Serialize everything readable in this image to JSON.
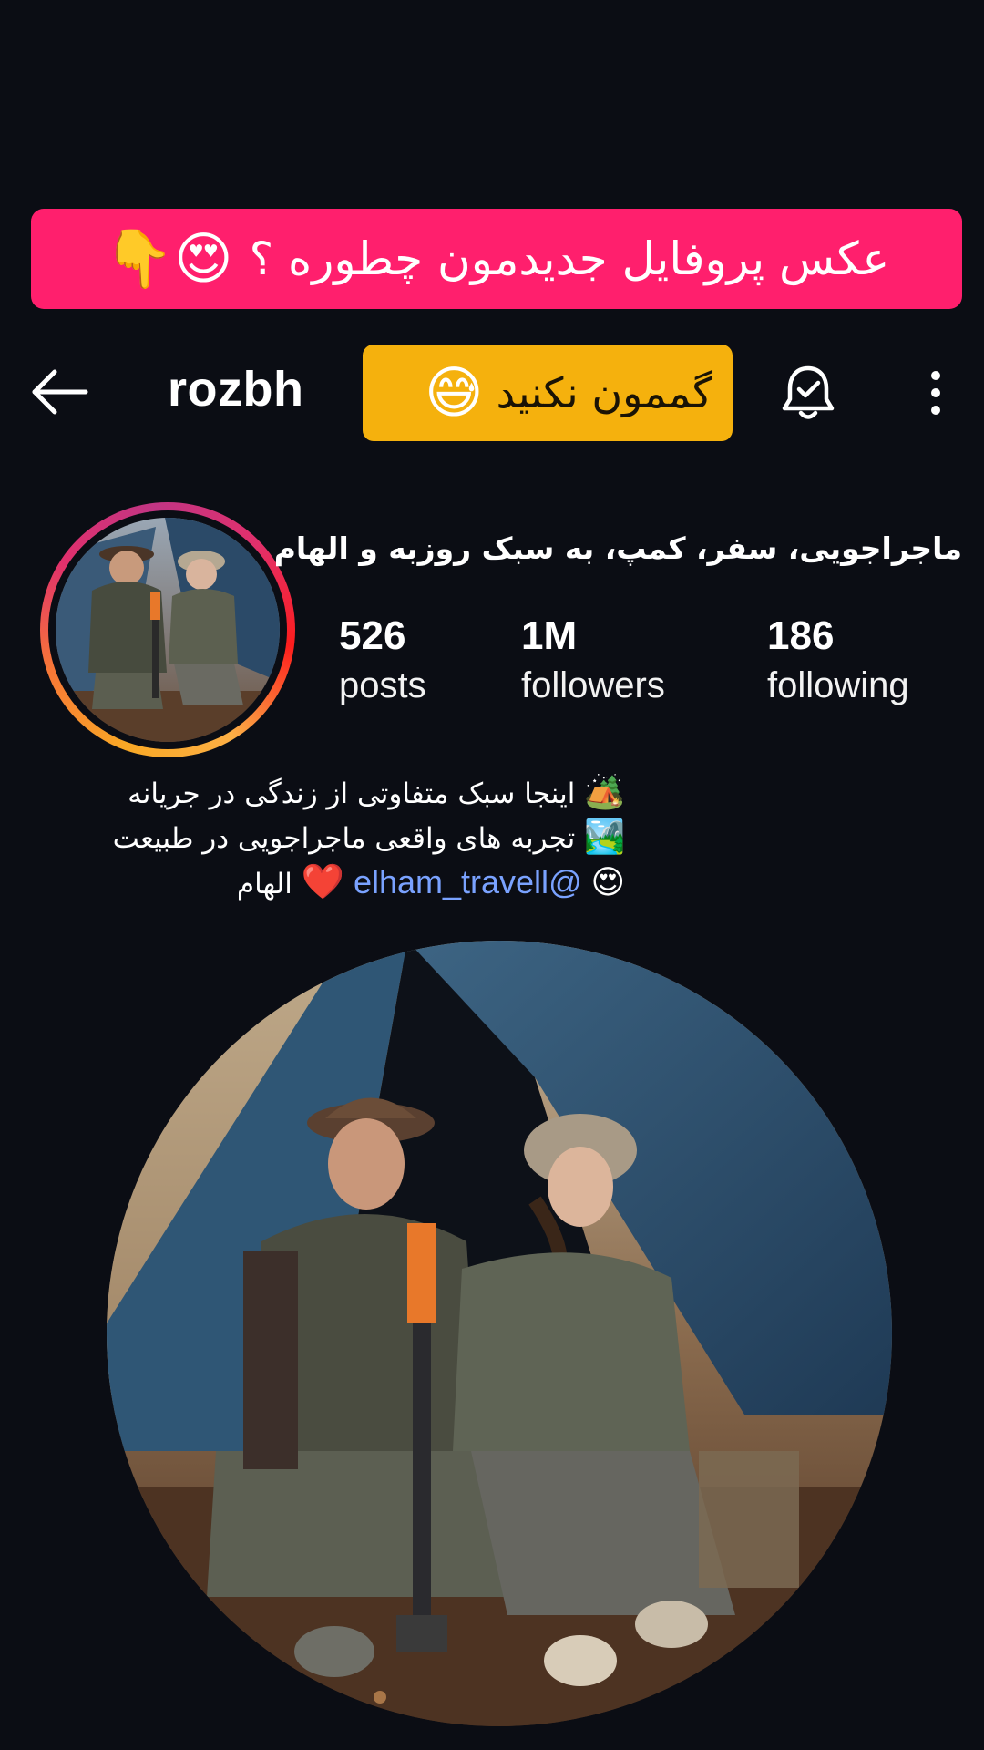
{
  "banner": {
    "text": "عکس پروفایل جدیدمون چطوره ؟",
    "emoji": "😍👇"
  },
  "header": {
    "username": "rozbh",
    "sticker_text": "گممون نکنید",
    "sticker_emoji": "😅",
    "icons": {
      "back": "back-arrow-icon",
      "bell": "notification-bell-icon",
      "more": "more-vertical-icon"
    }
  },
  "profile": {
    "title": "ماجراجویی، سفر، کمپ، به سبک روزبه و الهام",
    "stats": [
      {
        "value": "526",
        "label": "posts"
      },
      {
        "value": "1M",
        "label": "followers"
      },
      {
        "value": "186",
        "label": "following"
      }
    ]
  },
  "bio": {
    "line1_emoji": "🏕️",
    "line1": "اینجا سبک متفاوتی از زندگی در جریانه",
    "line2_emoji": "🏞️",
    "line2": "تجربه های واقعی ماجراجویی در طبیعت",
    "line3_emoji": "😍",
    "mention": "@elham_travell",
    "line3_heart": "❤️",
    "line3_text": "الهام"
  },
  "colors": {
    "banner": "#ff1f6d",
    "sticker": "#f5b10d",
    "background": "#0b0d14",
    "mention": "#7aa2ff"
  }
}
